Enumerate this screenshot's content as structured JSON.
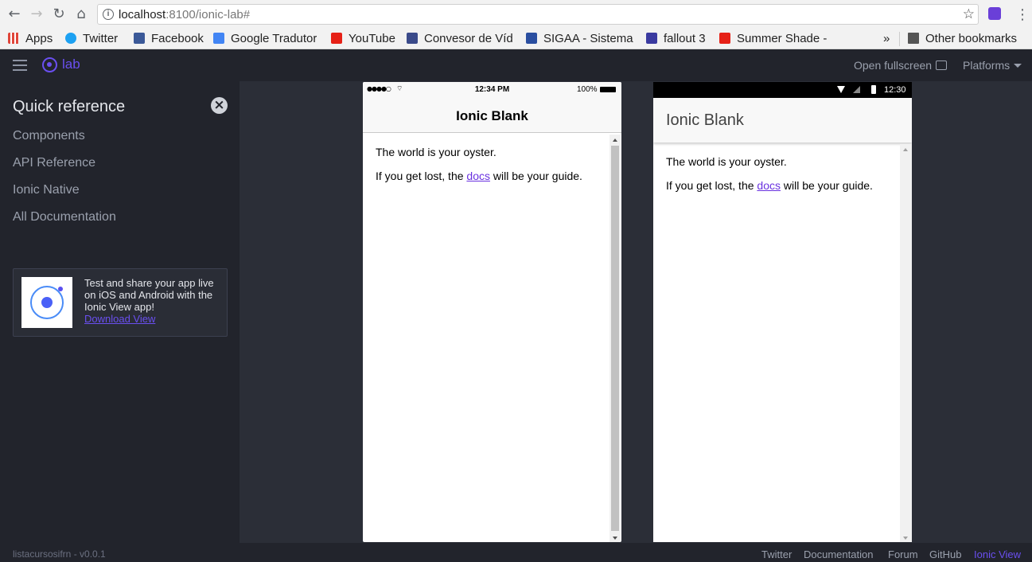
{
  "browser": {
    "url_host": "localhost",
    "url_path": ":8100/ionic-lab#",
    "bookmarks": [
      {
        "label": "Apps",
        "color": "#e0463a"
      },
      {
        "label": "Twitter",
        "color": "#1da1f2"
      },
      {
        "label": "Facebook",
        "color": "#3b5998"
      },
      {
        "label": "Google Tradutor",
        "color": "#4285f4"
      },
      {
        "label": "YouTube",
        "color": "#e62117"
      },
      {
        "label": "Convesor de Víd",
        "color": "#3a4a8a"
      },
      {
        "label": "SIGAA - Sistema",
        "color": "#2a4ea0"
      },
      {
        "label": "fallout 3",
        "color": "#3a3aa0"
      },
      {
        "label": "Summer Shade -",
        "color": "#e62117"
      }
    ],
    "overflow": "»",
    "other_bookmarks": "Other bookmarks"
  },
  "lab": {
    "logo_text": "lab",
    "open_fullscreen": "Open fullscreen",
    "platforms": "Platforms",
    "sidebar": {
      "title": "Quick reference",
      "links": [
        "Components",
        "API Reference",
        "Ionic Native",
        "All Documentation"
      ],
      "promo_text": "Test and share your app live on iOS and Android with the Ionic View app!",
      "promo_link": "Download View"
    },
    "footer": {
      "version": "listacursosifrn - v0.0.1",
      "links": [
        "Twitter",
        "Documentation",
        "Forum",
        "GitHub",
        "Ionic View"
      ]
    }
  },
  "ios": {
    "time": "12:34 PM",
    "battery": "100%",
    "title": "Ionic Blank",
    "line1": "The world is your oyster.",
    "line2_pre": "If you get lost, the ",
    "line2_link": "docs",
    "line2_post": " will be your guide."
  },
  "android": {
    "time": "12:30",
    "title": "Ionic Blank",
    "line1": "The world is your oyster.",
    "line2_pre": "If you get lost, the ",
    "line2_link": "docs",
    "line2_post": " will be your guide."
  },
  "colors": {
    "accent": "#6a4ff0",
    "link": "#6a32e0"
  }
}
